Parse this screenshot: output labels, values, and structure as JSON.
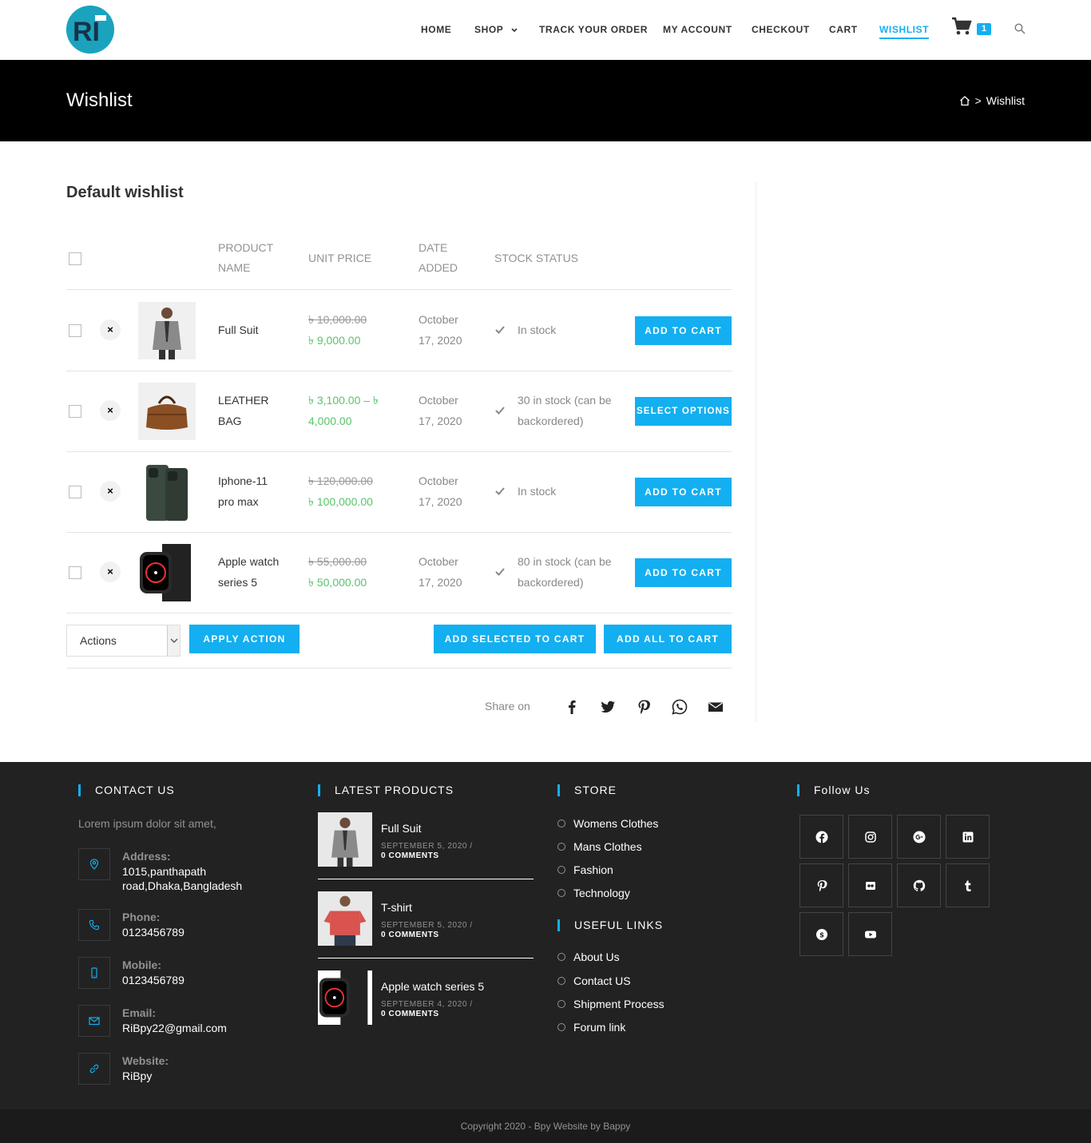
{
  "header": {
    "logo_text": "RI",
    "nav": [
      {
        "label": "HOME"
      },
      {
        "label": "SHOP"
      },
      {
        "label": "TRACK YOUR ORDER"
      },
      {
        "label": "MY ACCOUNT"
      },
      {
        "label": "CHECKOUT"
      },
      {
        "label": "CART"
      },
      {
        "label": "WISHLIST"
      }
    ],
    "cart_count": "1",
    "accent": "#13aff0"
  },
  "banner": {
    "title": "Wishlist",
    "breadcrumb_current": "Wishlist",
    "breadcrumb_sep": ">"
  },
  "wishlist": {
    "title": "Default wishlist",
    "columns": {
      "product_name": "PRODUCT NAME",
      "unit_price": "UNIT PRICE",
      "date_added": "DATE ADDED",
      "stock_status": "STOCK STATUS"
    },
    "items": [
      {
        "name": "Full Suit",
        "price_old": "৳ 10,000.00",
        "price_new": "৳ 9,000.00",
        "date": "October 17, 2020",
        "stock": "In stock",
        "button": "ADD TO CART",
        "remove": "×"
      },
      {
        "name": "LEATHER BAG",
        "price_old": "",
        "price_new": "৳ 3,100.00 – ৳ 4,000.00",
        "date": "October 17, 2020",
        "stock": "30 in stock (can be backordered)",
        "button": "SELECT OPTIONS",
        "remove": "×"
      },
      {
        "name": "Iphone-11 pro max",
        "price_old": "৳ 120,000.00",
        "price_new": "৳ 100,000.00",
        "date": "October 17, 2020",
        "stock": "In stock",
        "button": "ADD TO CART",
        "remove": "×"
      },
      {
        "name": "Apple watch series 5",
        "price_old": "৳ 55,000.00",
        "price_new": "৳ 50,000.00",
        "date": "October 17, 2020",
        "stock": "80 in stock (can be backordered)",
        "button": "ADD TO CART",
        "remove": "×"
      }
    ],
    "actions_select": "Actions",
    "apply_action": "APPLY ACTION",
    "add_selected": "ADD SELECTED TO CART",
    "add_all": "ADD ALL TO CART",
    "share_label": "Share on"
  },
  "footer": {
    "contact": {
      "title": "CONTACT US",
      "intro": "Lorem ipsum dolor sit amet,",
      "address_label": "Address:",
      "address_line1": "1015,panthapath",
      "address_line2": "road,Dhaka,Bangladesh",
      "phone_label": "Phone:",
      "phone": "0123456789",
      "mobile_label": "Mobile:",
      "mobile": "0123456789",
      "email_label": "Email:",
      "email": "RiBpy22@gmail.com",
      "website_label": "Website:",
      "website": "RiBpy"
    },
    "latest": {
      "title": "LATEST PRODUCTS",
      "items": [
        {
          "title": "Full Suit",
          "date": "SEPTEMBER 5, 2020 /",
          "comments": "0 COMMENTS"
        },
        {
          "title": "T-shirt",
          "date": "SEPTEMBER 5, 2020 /",
          "comments": "0 COMMENTS"
        },
        {
          "title": "Apple watch series 5",
          "date": "SEPTEMBER 4, 2020 /",
          "comments": "0 COMMENTS"
        }
      ]
    },
    "store": {
      "title": "STORE",
      "links": [
        "Womens Clothes",
        "Mans Clothes",
        "Fashion",
        "Technology"
      ]
    },
    "useful": {
      "title": "USEFUL LINKS",
      "links": [
        "About Us",
        "Contact US",
        "Shipment Process",
        "Forum link"
      ]
    },
    "follow": {
      "title": "Follow Us",
      "icons": [
        "facebook-icon",
        "instagram-icon",
        "google-plus-icon",
        "linkedin-icon",
        "pinterest-icon",
        "flickr-icon",
        "github-icon",
        "tumblr-icon",
        "skype-icon",
        "youtube-icon"
      ]
    },
    "copyright": "Copyright 2020 - Bpy Website by Bappy"
  }
}
